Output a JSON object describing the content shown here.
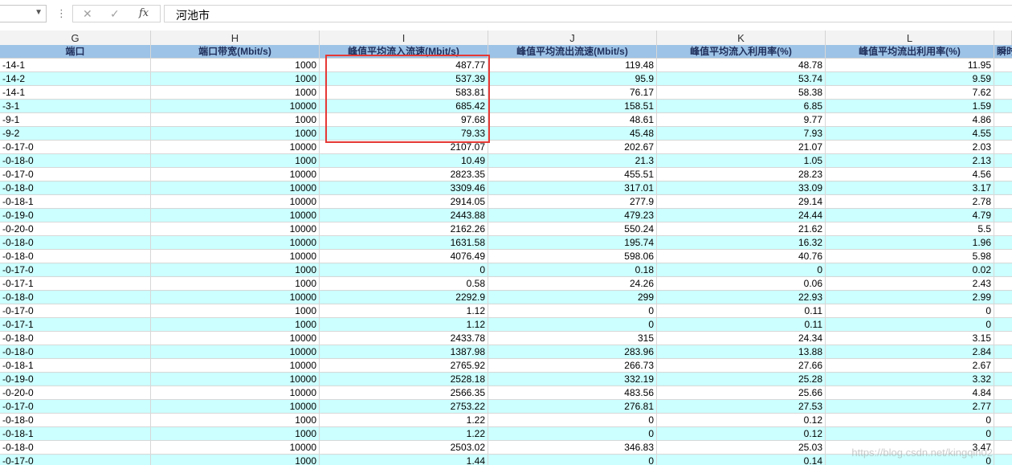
{
  "formula_bar": {
    "cancel_glyph": "✕",
    "enter_glyph": "✓",
    "fx_label": "fx",
    "value": "河池市",
    "dots": "⋮"
  },
  "columns": [
    "G",
    "H",
    "I",
    "J",
    "K",
    "L"
  ],
  "headers": [
    "端口",
    "端口带宽(Mbit/s)",
    "峰值平均流入流速(Mbit/s)",
    "峰值平均流出流速(Mbit/s)",
    "峰值平均流入利用率(%)",
    "峰值平均流出利用率(%)",
    "瞬时"
  ],
  "rows": [
    [
      "-14-1",
      "1000",
      "487.77",
      "119.48",
      "48.78",
      "11.95"
    ],
    [
      "-14-2",
      "1000",
      "537.39",
      "95.9",
      "53.74",
      "9.59"
    ],
    [
      "-14-1",
      "1000",
      "583.81",
      "76.17",
      "58.38",
      "7.62"
    ],
    [
      "-3-1",
      "10000",
      "685.42",
      "158.51",
      "6.85",
      "1.59"
    ],
    [
      "-9-1",
      "1000",
      "97.68",
      "48.61",
      "9.77",
      "4.86"
    ],
    [
      "-9-2",
      "1000",
      "79.33",
      "45.48",
      "7.93",
      "4.55"
    ],
    [
      "-0-17-0",
      "10000",
      "2107.07",
      "202.67",
      "21.07",
      "2.03"
    ],
    [
      "-0-18-0",
      "1000",
      "10.49",
      "21.3",
      "1.05",
      "2.13"
    ],
    [
      "-0-17-0",
      "10000",
      "2823.35",
      "455.51",
      "28.23",
      "4.56"
    ],
    [
      "-0-18-0",
      "10000",
      "3309.46",
      "317.01",
      "33.09",
      "3.17"
    ],
    [
      "-0-18-1",
      "10000",
      "2914.05",
      "277.9",
      "29.14",
      "2.78"
    ],
    [
      "-0-19-0",
      "10000",
      "2443.88",
      "479.23",
      "24.44",
      "4.79"
    ],
    [
      "-0-20-0",
      "10000",
      "2162.26",
      "550.24",
      "21.62",
      "5.5"
    ],
    [
      "-0-18-0",
      "10000",
      "1631.58",
      "195.74",
      "16.32",
      "1.96"
    ],
    [
      "-0-18-0",
      "10000",
      "4076.49",
      "598.06",
      "40.76",
      "5.98"
    ],
    [
      "-0-17-0",
      "1000",
      "0",
      "0.18",
      "0",
      "0.02"
    ],
    [
      "-0-17-1",
      "1000",
      "0.58",
      "24.26",
      "0.06",
      "2.43"
    ],
    [
      "-0-18-0",
      "10000",
      "2292.9",
      "299",
      "22.93",
      "2.99"
    ],
    [
      "-0-17-0",
      "1000",
      "1.12",
      "0",
      "0.11",
      "0"
    ],
    [
      "-0-17-1",
      "1000",
      "1.12",
      "0",
      "0.11",
      "0"
    ],
    [
      "-0-18-0",
      "10000",
      "2433.78",
      "315",
      "24.34",
      "3.15"
    ],
    [
      "-0-18-0",
      "10000",
      "1387.98",
      "283.96",
      "13.88",
      "2.84"
    ],
    [
      "-0-18-1",
      "10000",
      "2765.92",
      "266.73",
      "27.66",
      "2.67"
    ],
    [
      "-0-19-0",
      "10000",
      "2528.18",
      "332.19",
      "25.28",
      "3.32"
    ],
    [
      "-0-20-0",
      "10000",
      "2566.35",
      "483.56",
      "25.66",
      "4.84"
    ],
    [
      "-0-17-0",
      "10000",
      "2753.22",
      "276.81",
      "27.53",
      "2.77"
    ],
    [
      "-0-18-0",
      "1000",
      "1.22",
      "0",
      "0.12",
      "0"
    ],
    [
      "-0-18-1",
      "1000",
      "1.22",
      "0",
      "0.12",
      "0"
    ],
    [
      "-0-18-0",
      "10000",
      "2503.02",
      "346.83",
      "25.03",
      "3.47"
    ],
    [
      "-0-17-0",
      "1000",
      "1.44",
      "0",
      "0.14",
      "0"
    ]
  ],
  "watermark": "https://blog.csdn.net/kingqin02",
  "colors": {
    "header_fill": "#9dc3e6",
    "alt_fill": "#ccffff",
    "highlight": "#e53935"
  }
}
